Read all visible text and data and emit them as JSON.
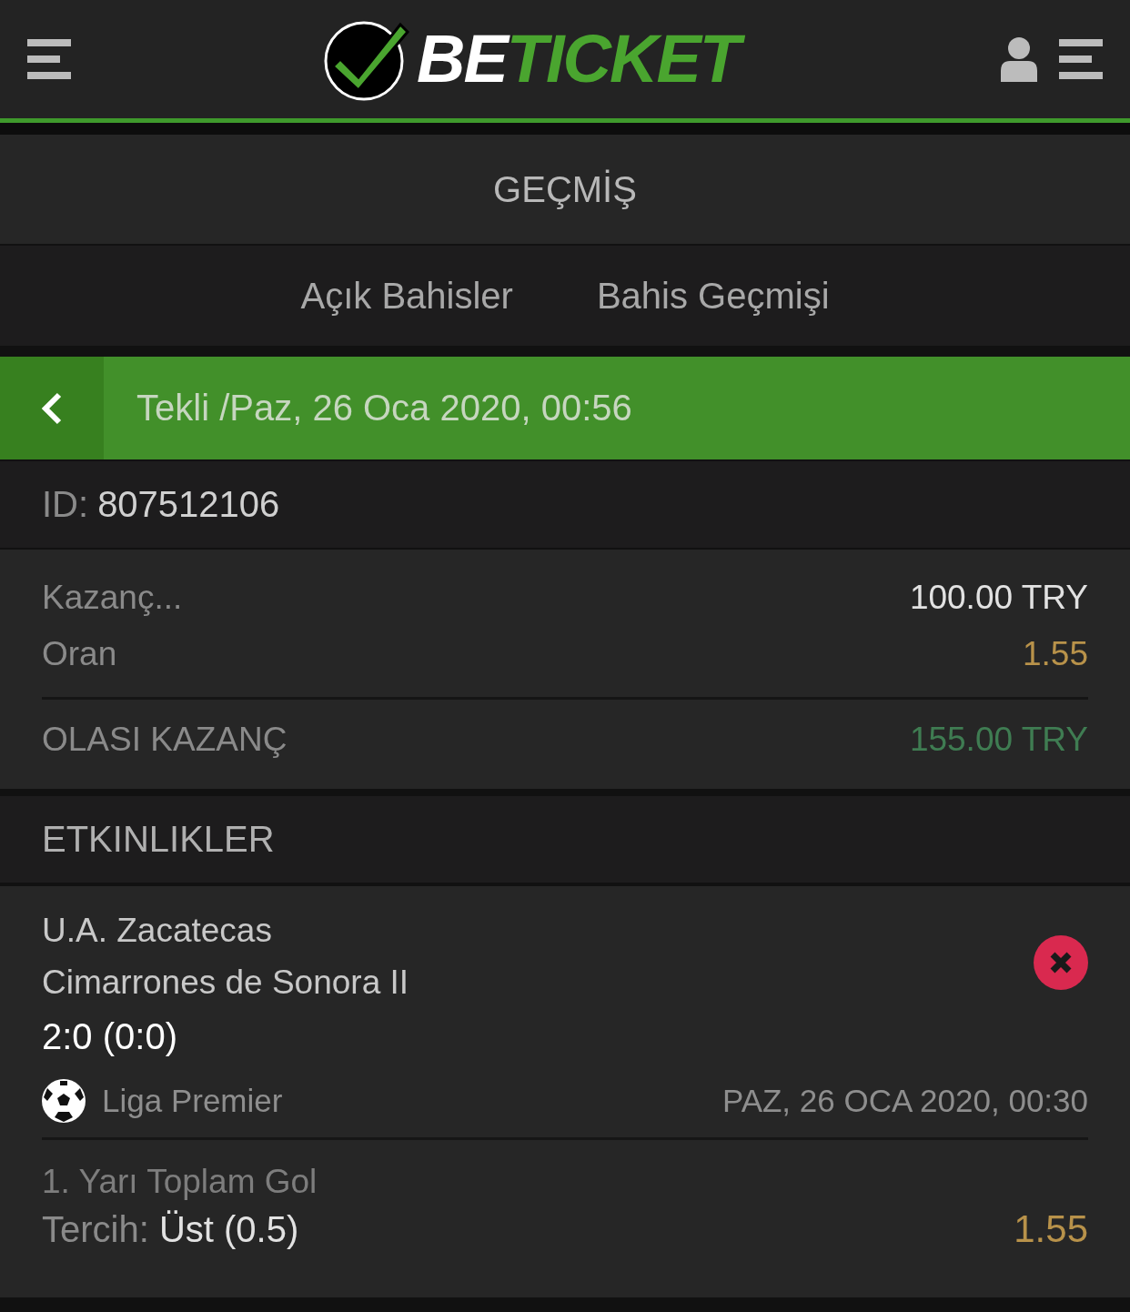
{
  "header": {
    "logo": {
      "part_1": "BE",
      "part_2": "TICKET"
    }
  },
  "page_title": "GEÇMİŞ",
  "tabs": [
    {
      "label": "Açık Bahisler"
    },
    {
      "label": "Bahis Geçmişi"
    }
  ],
  "detail_bar": {
    "title": "Tekli /Paz, 26 Oca 2020, 00:56"
  },
  "ticket_id": {
    "label": "ID:",
    "value": "807512106"
  },
  "summary": {
    "stake_label": "Kazanç...",
    "stake": "100.00 TRY",
    "odds_label": "Oran",
    "odds": "1.55",
    "potential_label": "OLASI KAZANÇ",
    "potential": "155.00 TRY"
  },
  "events_heading": "ETKINLIKLER",
  "events": [
    {
      "home": "U.A. Zacatecas",
      "away": "Cimarrones de Sonora II",
      "score": "2:0 (0:0)",
      "league": "Liga Premier",
      "date": "PAZ, 26 OCA 2020, 00:30",
      "market": "1. Yarı Toplam Gol",
      "pick_label": "Tercih:",
      "pick": "Üst (0.5)",
      "odds": "1.55"
    }
  ]
}
